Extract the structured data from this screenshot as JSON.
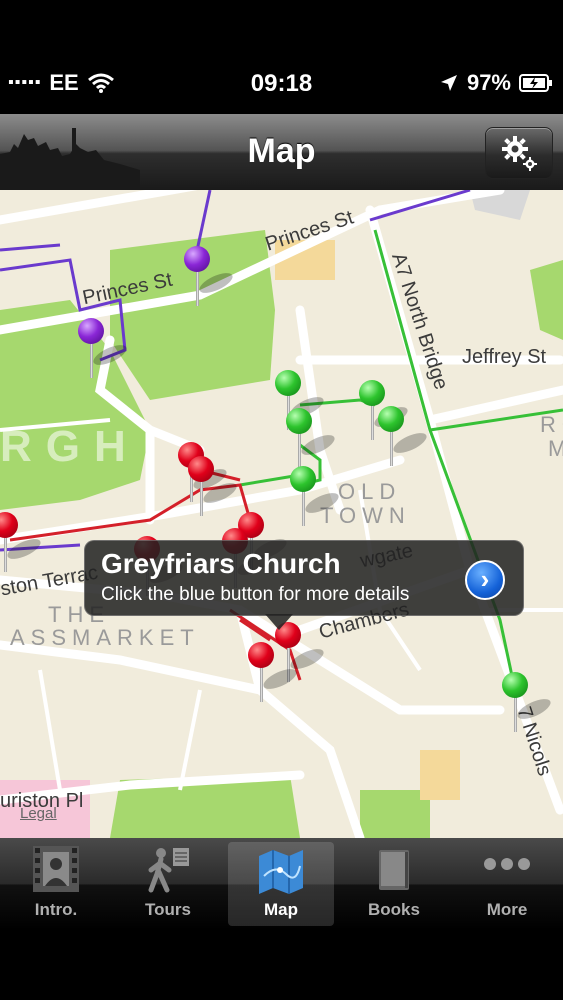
{
  "status_bar": {
    "carrier": "EE",
    "time": "09:18",
    "battery": "97%"
  },
  "nav_bar": {
    "title": "Map",
    "settings_icon": "gear-icon"
  },
  "map": {
    "street_labels": {
      "princes_st_1": "Princes St",
      "princes_st_2": "Princes St",
      "jeffrey_st": "Jeffrey St",
      "north_bridge": "A7 North Bridge",
      "chambers": "Chambers",
      "cowgate": "wgate",
      "terrace": "ston Terrac",
      "lauriston": "uriston Pl",
      "nicolson": "7 Nicols"
    },
    "area_labels": {
      "old": "OLD",
      "town": "TOWN",
      "the": "THE",
      "grassmarket": "ASSMARKET",
      "burgh": "RGH",
      "ro": "RO",
      "m": "M"
    },
    "legal": "Legal",
    "callout": {
      "title": "Greyfriars Church",
      "subtitle": "Click the blue button for more details",
      "disclosure_icon": "chevron-right-icon"
    },
    "pin_colors": {
      "red": "#e0001a",
      "green": "#2dc42d",
      "purple": "#8a26d6"
    }
  },
  "tab_bar": {
    "tabs": [
      {
        "label": "Intro.",
        "icon": "film-strip-icon",
        "active": false
      },
      {
        "label": "Tours",
        "icon": "walking-person-icon",
        "active": false
      },
      {
        "label": "Map",
        "icon": "map-icon",
        "active": true
      },
      {
        "label": "Books",
        "icon": "book-icon",
        "active": false
      },
      {
        "label": "More",
        "icon": "more-dots-icon",
        "active": false
      }
    ]
  }
}
